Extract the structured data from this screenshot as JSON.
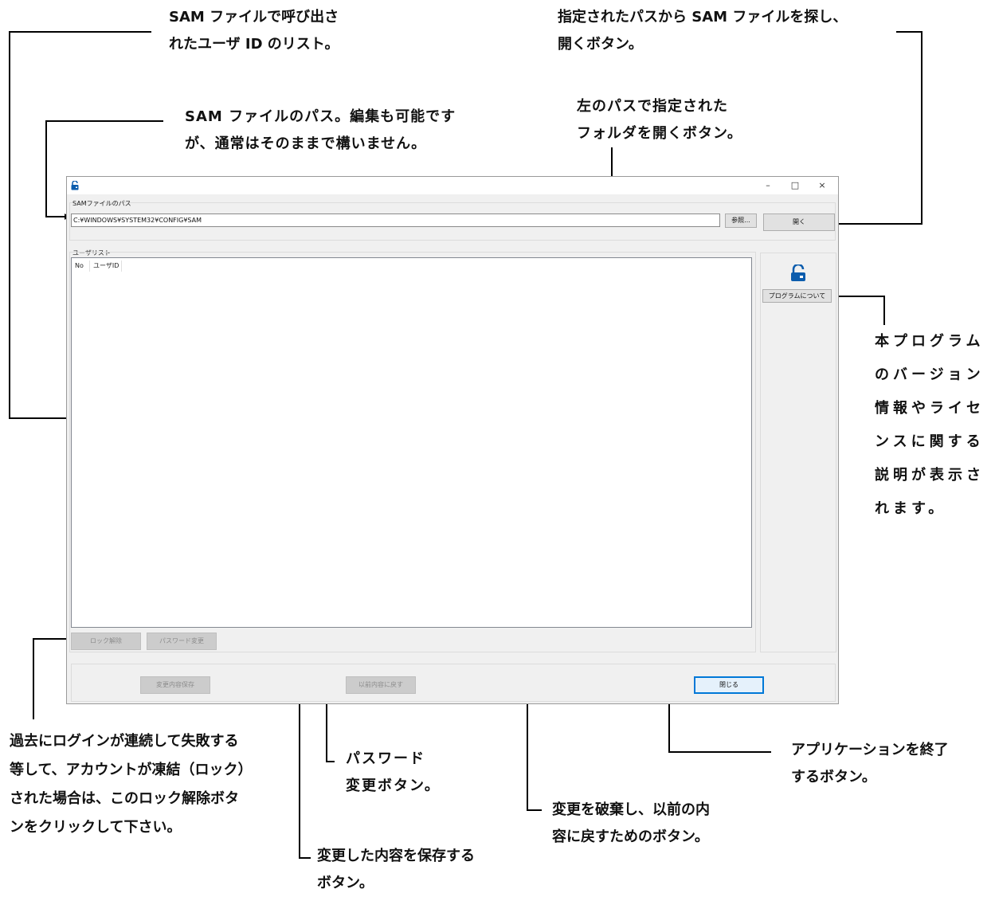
{
  "annotations": {
    "user_list": "SAM ファイルで呼び出さ\nれたユーザ ID のリスト。",
    "open_button": "指定されたパスから SAM ファイルを探し、\n開くボタン。",
    "path_field": "SAM ファイルのパス。編集も可能です\nが、通常はそのままで構いません。",
    "browse_button": "左のパスで指定された\nフォルダを開くボタン。",
    "about_button": "本プログラム\nのバージョン\n情報やライセ\nンスに関する\n説明が表示さ\nれます。",
    "unlock_button": "過去にログインが連続して失敗する\n等して、アカウントが凍結（ロック）\nされた場合は、このロック解除ボタ\nンをクリックして下さい。",
    "password_button": "パスワード\n変更ボタン。",
    "save_button": "変更した内容を保存する\nボタン。",
    "revert_button": "変更を破棄し、以前の内\n容に戻すためのボタン。",
    "close_button": "アプリケーションを終了\nするボタン。"
  },
  "window": {
    "controls": {
      "minimize": "–",
      "maximize": "□",
      "close": "×"
    },
    "path_group_label": "SAMファイルのパス",
    "path_value": "C:¥WINDOWS¥SYSTEM32¥CONFIG¥SAM",
    "browse_label": "参照...",
    "open_label": "開く",
    "user_list_label": "ユーザリスト",
    "columns": [
      "No",
      "ユーザID"
    ],
    "about_label": "プログラムについて",
    "unlock_label": "ロック解除",
    "change_password_label": "パスワード変更",
    "save_label": "変更内容保存",
    "revert_label": "以前内容に戻す",
    "close_label": "閉じる"
  },
  "icons": {
    "app_icon": "unlocked-padlock-icon",
    "side_icon": "unlocked-padlock-icon"
  },
  "colors": {
    "accent": "#0078d7",
    "window_bg": "#f0f0f0",
    "annotation_text": "#111111"
  }
}
